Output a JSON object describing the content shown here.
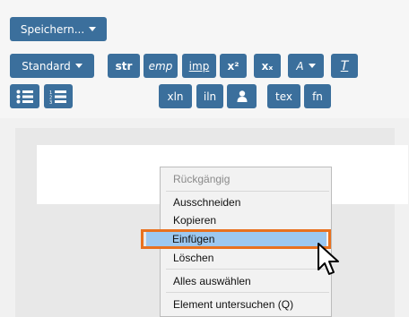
{
  "toolbar": {
    "save_label": "Speichern...",
    "style_label": "Standard",
    "str": "str",
    "emp": "emp",
    "imp": "imp",
    "sup": "x²",
    "sub": "xₓ",
    "font": "A",
    "clear": "T",
    "xln": "xln",
    "iln": "iln",
    "tex": "tex",
    "fn": "fn"
  },
  "context_menu": {
    "undo": "Rückgängig",
    "cut": "Ausschneiden",
    "copy": "Kopieren",
    "paste": "Einfügen",
    "delete": "Löschen",
    "select_all": "Alles auswählen",
    "inspect": "Element untersuchen (Q)"
  },
  "colors": {
    "button": "#3b6f9c",
    "highlight": "#9cc8f0",
    "outline": "#e8711f"
  }
}
